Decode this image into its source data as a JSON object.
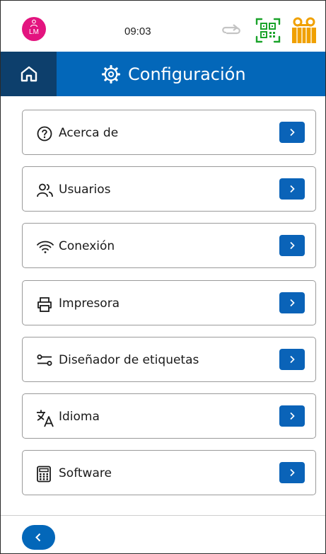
{
  "status": {
    "user_initials": "LM",
    "time": "09:03",
    "icons": [
      "user-icon",
      "sync-icon",
      "qr-code-icon",
      "tape-cassette-icon"
    ],
    "colors": {
      "avatar": "#e3147f",
      "qr": "#1aa32a",
      "tape": "#f0a000"
    }
  },
  "header": {
    "title": "Configuración",
    "icons": [
      "home-icon",
      "gear-icon"
    ],
    "colors": {
      "bar": "#0367b9",
      "home": "#0d3f6c"
    }
  },
  "menu": {
    "items": [
      {
        "label": "Acerca de",
        "icon": "help-circle-icon"
      },
      {
        "label": "Usuarios",
        "icon": "users-icon"
      },
      {
        "label": "Conexión",
        "icon": "wifi-icon"
      },
      {
        "label": "Impresora",
        "icon": "printer-icon"
      },
      {
        "label": "Diseñador de etiquetas",
        "icon": "label-designer-icon"
      },
      {
        "label": "Idioma",
        "icon": "translate-icon"
      },
      {
        "label": "Software",
        "icon": "calculator-icon"
      }
    ],
    "arrow_icon": "chevron-right-icon",
    "arrow_color": "#0a63b8"
  },
  "footer": {
    "back_icon": "chevron-left-icon"
  }
}
